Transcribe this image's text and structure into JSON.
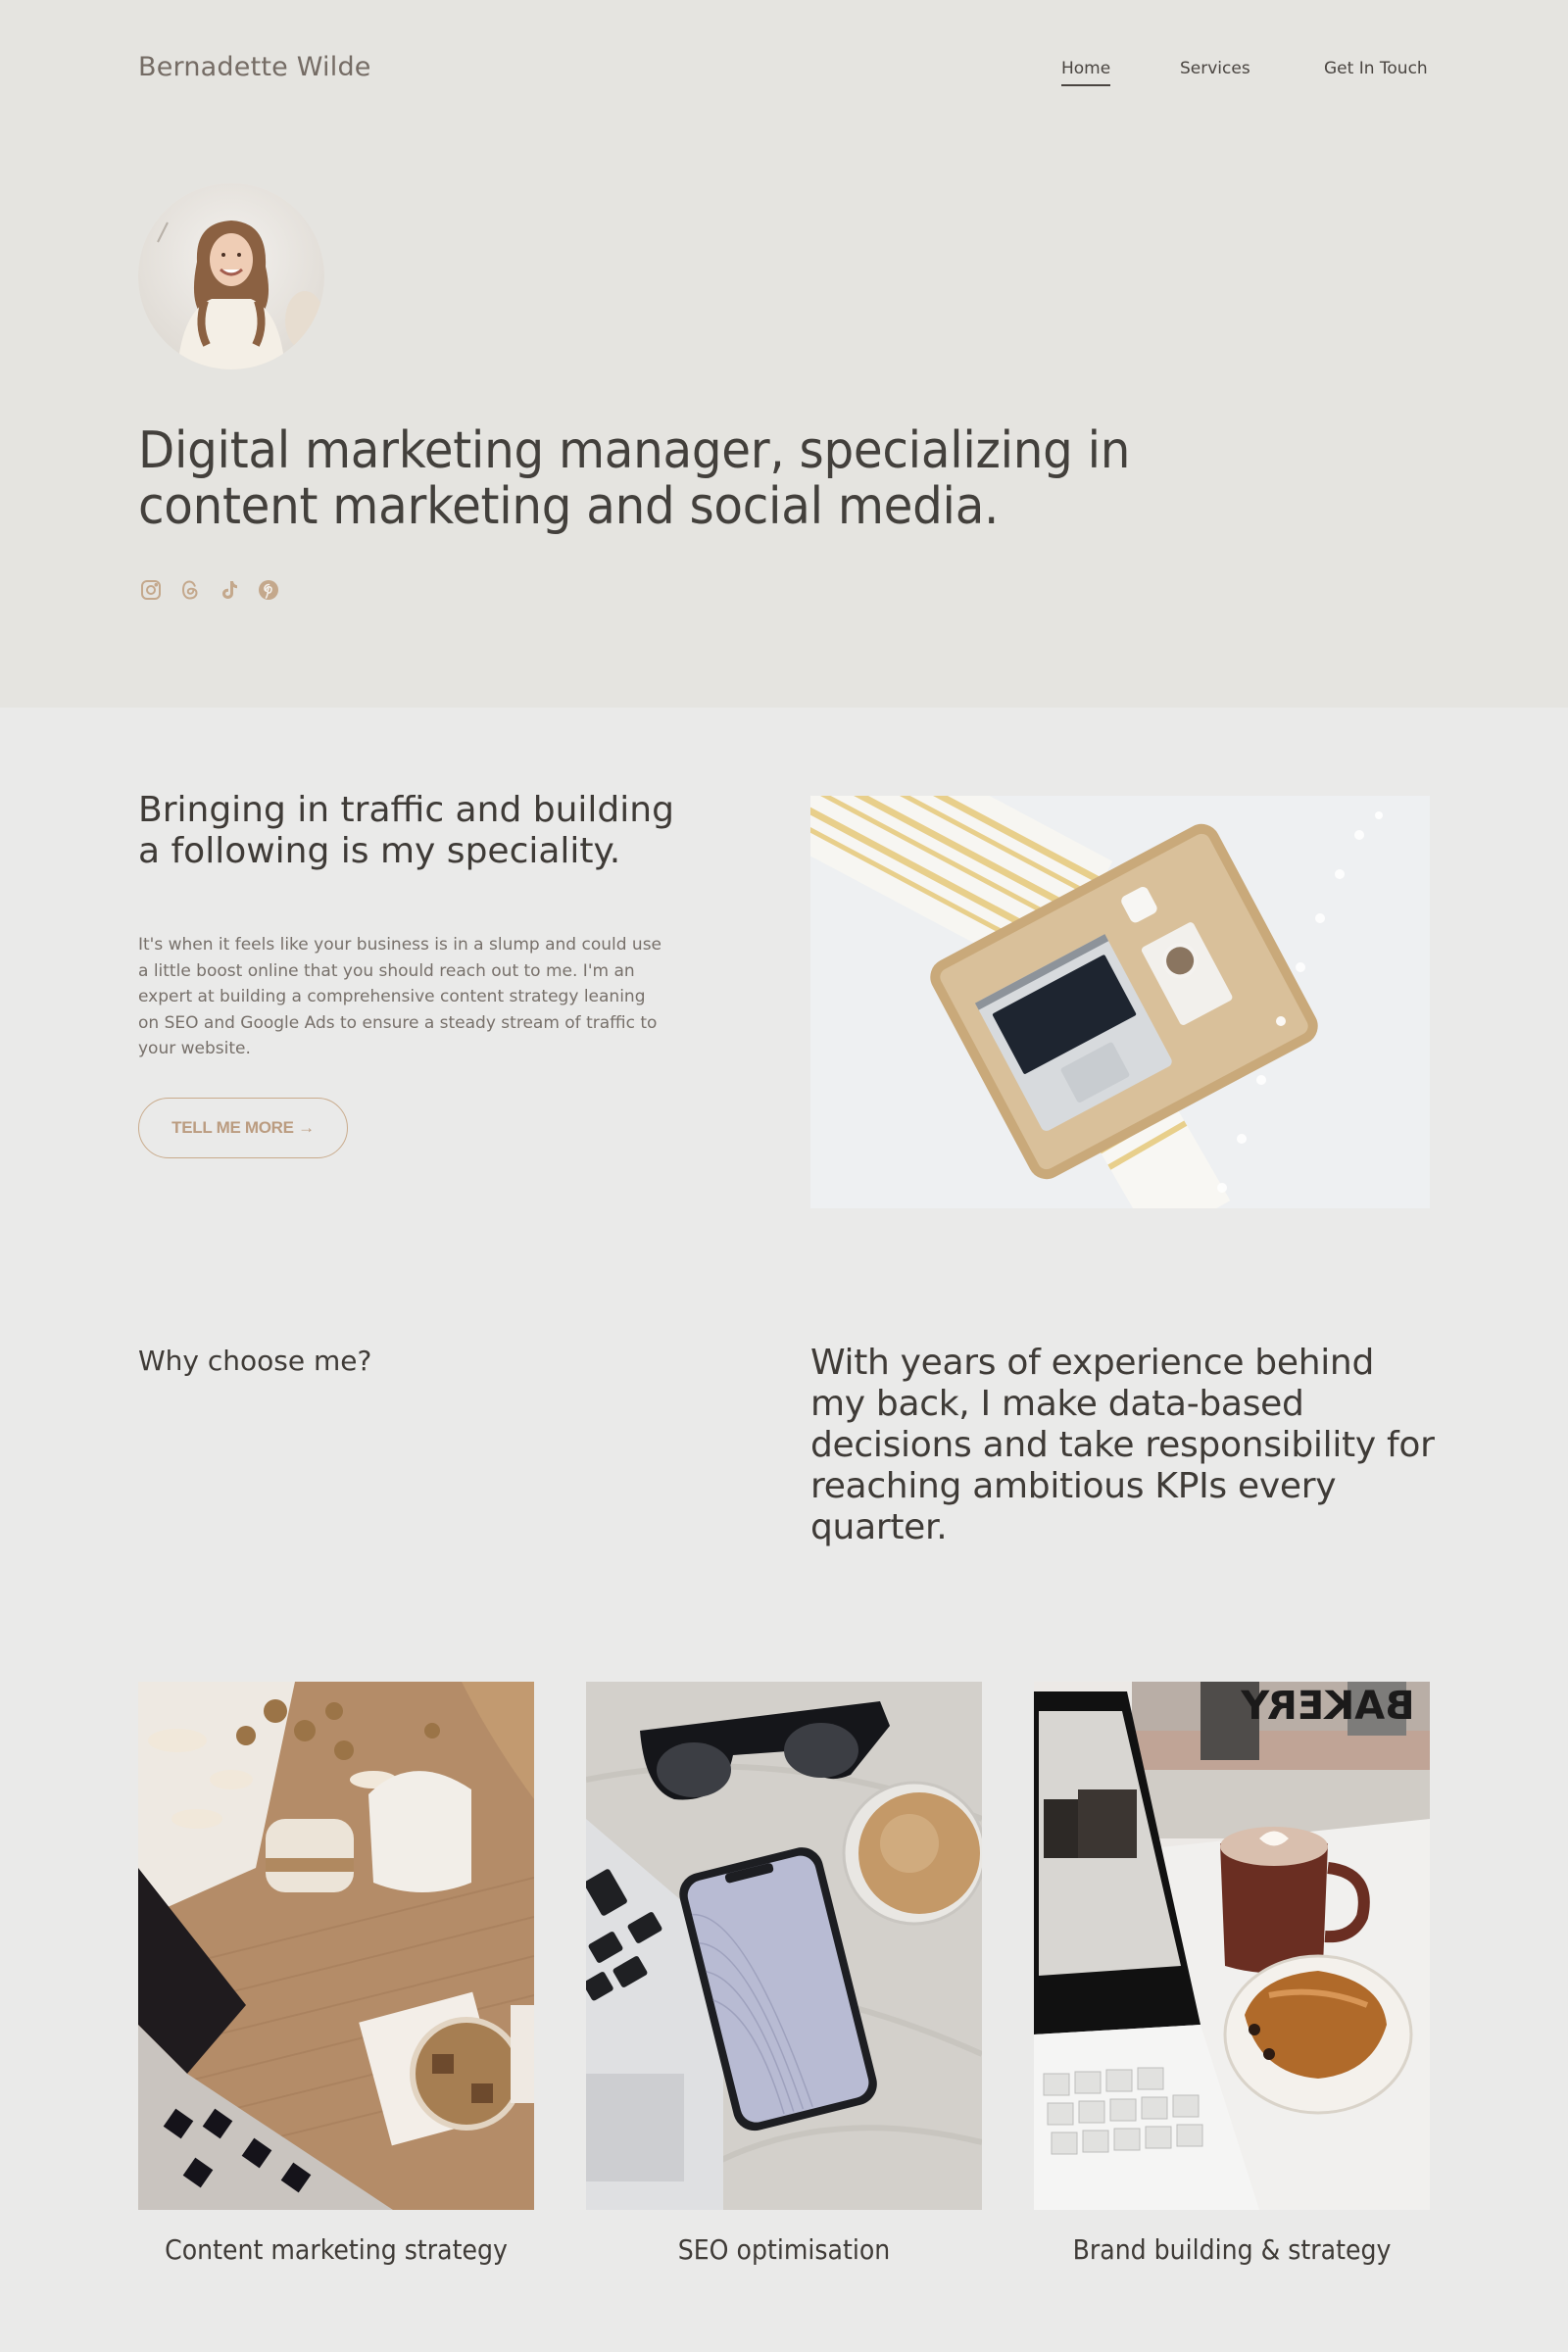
{
  "header": {
    "brand": "Bernadette Wilde",
    "nav": [
      {
        "label": "Home",
        "active": true
      },
      {
        "label": "Services",
        "active": false
      },
      {
        "label": "Get In Touch",
        "active": false
      }
    ]
  },
  "hero": {
    "avatar_alt": "Portrait of Bernadette Wilde",
    "title": "Digital marketing manager, specializing in content marketing and social media.",
    "socials": [
      {
        "name": "instagram-icon",
        "label": "Instagram"
      },
      {
        "name": "threads-icon",
        "label": "Threads"
      },
      {
        "name": "tiktok-icon",
        "label": "TikTok"
      },
      {
        "name": "pinterest-icon",
        "label": "Pinterest"
      }
    ]
  },
  "speciality": {
    "title": "Bringing in traffic and building a following is my speciality.",
    "body": "It's when it feels like your business is in a slump and could use a little boost online that you should reach out to me. I'm an expert at building a comprehensive content strategy leaning on SEO and Google Ads to ensure a steady stream of traffic to your website.",
    "button_label": "TELL ME MORE →",
    "image_alt": "Laptop on a wicker tray with coffee on a white bed"
  },
  "why": {
    "label": "Why choose me?",
    "text": "With years of experience behind my back, I make data-based decisions and take responsibility for reaching ambitious KPIs every quarter."
  },
  "services": [
    {
      "title": "Content marketing strategy",
      "image_alt": "Laptop, dried flowers and iced coffee on a wooden desk"
    },
    {
      "title": "SEO optimisation",
      "image_alt": "Smartphone, sunglasses, laptop and cappuccino on marble"
    },
    {
      "title": "Brand building & strategy",
      "image_alt": "Laptop, latte and pain au chocolat at a bakery window"
    }
  ],
  "colors": {
    "hero_bg": "#e5e4e0",
    "page_bg": "#eaeae9",
    "text": "#3f3b37",
    "brand": "#756c65",
    "accent": "#c9ab8c"
  }
}
